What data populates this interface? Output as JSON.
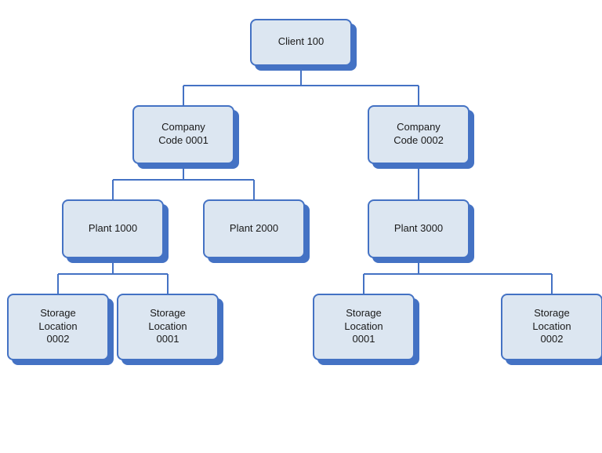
{
  "nodes": {
    "client": {
      "label": "Client 100"
    },
    "company1": {
      "label": "Company\nCode 0001"
    },
    "company2": {
      "label": "Company\nCode 0002"
    },
    "plant1": {
      "label": "Plant 1000"
    },
    "plant2": {
      "label": "Plant 2000"
    },
    "plant3": {
      "label": "Plant 3000"
    },
    "storage1": {
      "label": "Storage\nLocation\n0002"
    },
    "storage2": {
      "label": "Storage\nLocation\n0001"
    },
    "storage3": {
      "label": "Storage\nLocation\n0001"
    },
    "storage4": {
      "label": "Storage\nLocation\n0002"
    }
  }
}
